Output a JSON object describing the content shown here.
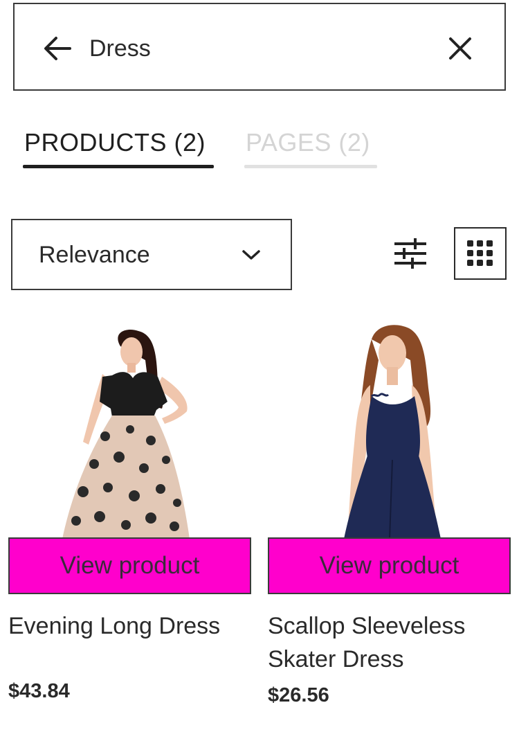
{
  "search": {
    "value": "Dress"
  },
  "tabs": [
    {
      "label": "PRODUCTS",
      "count": "(2)",
      "active": true
    },
    {
      "label": "PAGES",
      "count": "(2)",
      "active": false
    }
  ],
  "sort": {
    "selected": "Relevance"
  },
  "icons": {
    "back": "arrow-left-icon",
    "clear": "close-icon",
    "sort_dropdown": "chevron-down-icon",
    "filter": "sliders-icon",
    "grid_view": "grid-icon"
  },
  "colors": {
    "accent": "#ff00cc",
    "text": "#222222",
    "inactive_tab": "#d4d4d4"
  },
  "products": [
    {
      "name": "Evening Long Dress",
      "price": "$43.84",
      "button_label": "View product"
    },
    {
      "name": "Scallop Sleeveless Skater Dress",
      "price": "$26.56",
      "button_label": "View product"
    }
  ]
}
